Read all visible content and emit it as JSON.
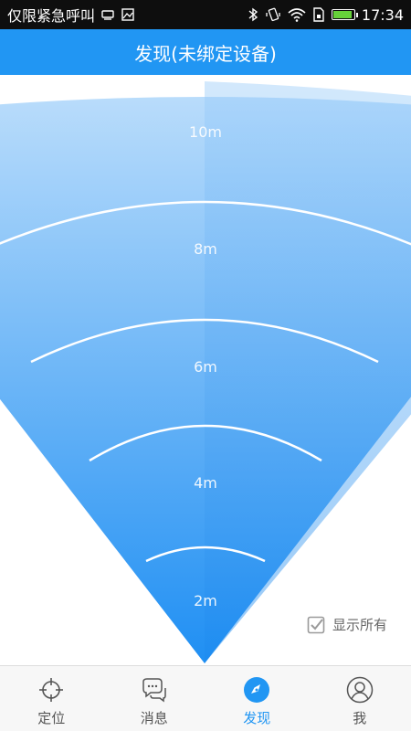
{
  "status_bar": {
    "left_text": "仅限紧急呼叫",
    "time": "17:34",
    "icons": [
      "sim-icon",
      "image-icon",
      "bluetooth-icon",
      "vibrate-icon",
      "wifi-icon",
      "sim-card-icon",
      "battery-icon"
    ]
  },
  "header": {
    "title": "发现(未绑定设备)"
  },
  "radar": {
    "rings": [
      "10m",
      "8m",
      "6m",
      "4m",
      "2m"
    ],
    "colors": {
      "top": "#b9dcfb",
      "bottom": "#1f8ff3",
      "ring_line": "#ffffff"
    }
  },
  "filter": {
    "show_all_label": "显示所有",
    "checked": true
  },
  "bottom_nav": {
    "items": [
      {
        "label": "定位",
        "icon": "crosshair-icon"
      },
      {
        "label": "消息",
        "icon": "chat-icon"
      },
      {
        "label": "发现",
        "icon": "compass-icon"
      },
      {
        "label": "我",
        "icon": "user-icon"
      }
    ],
    "active_index": 2
  },
  "colors": {
    "accent": "#2196f3",
    "status_bar": "#0e0e0e"
  }
}
